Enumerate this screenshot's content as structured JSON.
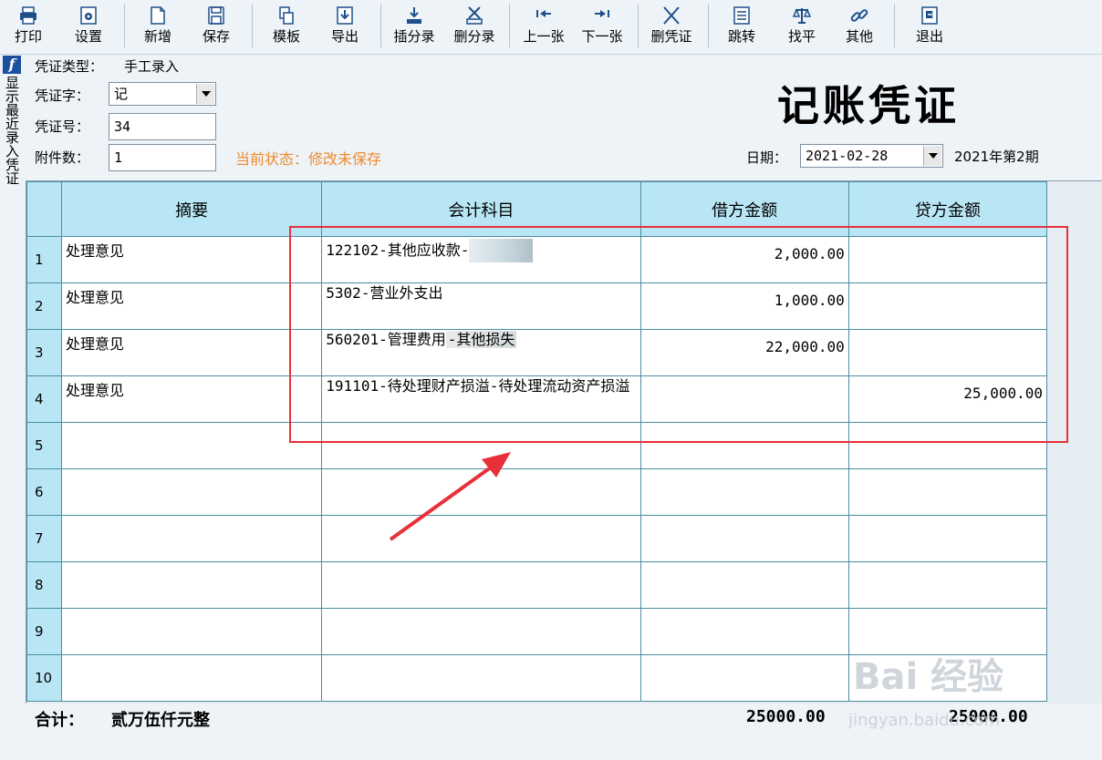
{
  "toolbar": {
    "print": "打印",
    "settings": "设置",
    "new": "新增",
    "save": "保存",
    "template": "模板",
    "export": "导出",
    "insert_entry": "插分录",
    "delete_entry": "删分录",
    "prev": "上一张",
    "next": "下一张",
    "delete_voucher": "删凭证",
    "jump": "跳转",
    "balance": "找平",
    "other": "其他",
    "exit": "退出"
  },
  "side": {
    "badge": "f",
    "vertical_label": "显示最近录入凭证"
  },
  "header": {
    "voucher_type_label": "凭证类型：",
    "voucher_type_value": "手工录入",
    "voucher_word_label": "凭证字：",
    "voucher_word_value": "记",
    "voucher_no_label": "凭证号：",
    "voucher_no_value": "34",
    "attachments_label": "附件数：",
    "attachments_value": "1",
    "status": "当前状态：修改未保存",
    "title": "记账凭证",
    "date_label": "日期：",
    "date_value": "2021-02-28",
    "period": "2021年第2期"
  },
  "grid": {
    "columns": [
      "摘要",
      "会计科目",
      "借方金额",
      "贷方金额"
    ],
    "rows": [
      {
        "no": "1",
        "summary": "处理意见",
        "account": "122102-其他应收款-",
        "debit": "2,000.00",
        "credit": ""
      },
      {
        "no": "2",
        "summary": "处理意见",
        "account": "5302-营业外支出",
        "debit": "1,000.00",
        "credit": ""
      },
      {
        "no": "3",
        "summary": "处理意见",
        "account": "560201-管理费用",
        "account_suffix": "-其他损失",
        "debit": "22,000.00",
        "credit": ""
      },
      {
        "no": "4",
        "summary": "处理意见",
        "account": "191101-待处理财产损溢-待处理流动资产损溢",
        "debit": "",
        "credit": "25,000.00"
      },
      {
        "no": "5",
        "summary": "",
        "account": "",
        "debit": "",
        "credit": ""
      },
      {
        "no": "6",
        "summary": "",
        "account": "",
        "debit": "",
        "credit": ""
      },
      {
        "no": "7",
        "summary": "",
        "account": "",
        "debit": "",
        "credit": ""
      },
      {
        "no": "8",
        "summary": "",
        "account": "",
        "debit": "",
        "credit": ""
      },
      {
        "no": "9",
        "summary": "",
        "account": "",
        "debit": "",
        "credit": ""
      },
      {
        "no": "10",
        "summary": "",
        "account": "",
        "debit": "",
        "credit": ""
      }
    ]
  },
  "totals": {
    "label": "合计：",
    "in_words": "贰万伍仟元整",
    "debit_total": "25000.00",
    "credit_total": "25000.00"
  },
  "watermark": {
    "brand": "Bai 经验",
    "url": "jingyan.baidu.com"
  },
  "colors": {
    "header_cell": "#b9e6f5",
    "grid_line": "#4d8da0",
    "status": "#f08a2a",
    "annotation": "#e8303a"
  }
}
